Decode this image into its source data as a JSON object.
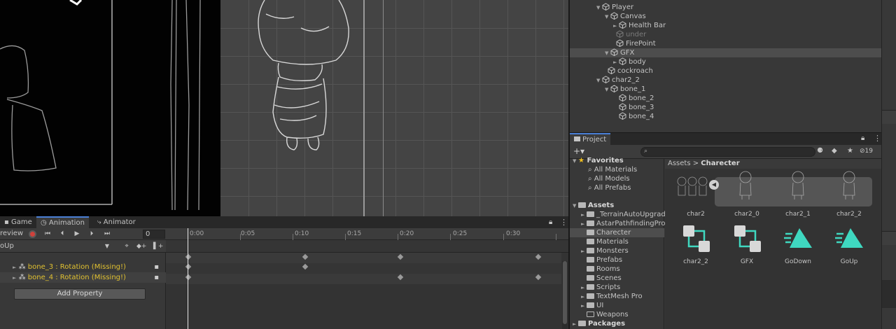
{
  "colors": {
    "accent": "#4a7fd5",
    "record": "#d0413b",
    "missing_property": "#e0c030",
    "keyframe": "#9a9a9a",
    "goup_icon": "#3fd8c0"
  },
  "hierarchy": {
    "items": [
      {
        "label": "Player",
        "icon": "cube-icon"
      },
      {
        "label": "Canvas",
        "icon": "cube-icon"
      },
      {
        "label": "Health Bar",
        "icon": "cube-icon"
      },
      {
        "label": "under",
        "icon": "cube-icon"
      },
      {
        "label": "FirePoint",
        "icon": "cube-icon"
      },
      {
        "label": "GFX",
        "icon": "cube-icon"
      },
      {
        "label": "body",
        "icon": "cube-icon"
      },
      {
        "label": "cockroach",
        "icon": "cube-icon"
      },
      {
        "label": "char2_2",
        "icon": "cube-icon"
      },
      {
        "label": "bone_1",
        "icon": "cube-icon"
      },
      {
        "label": "bone_2",
        "icon": "cube-icon"
      },
      {
        "label": "bone_3",
        "icon": "cube-icon"
      },
      {
        "label": "bone_4",
        "icon": "cube-icon"
      }
    ]
  },
  "project": {
    "tab_label": "Project",
    "hidden_count": "19",
    "breadcrumb": {
      "root": "Assets",
      "current": "Charecter"
    },
    "tree": {
      "favorites_label": "Favorites",
      "favorites": [
        "All Materials",
        "All Models",
        "All Prefabs"
      ],
      "assets_label": "Assets",
      "folders": [
        "_TerrainAutoUpgrade",
        "AstarPathfindingProject",
        "Charecter",
        "Materials",
        "Monsters",
        "Prefabs",
        "Rooms",
        "Scenes",
        "Scripts",
        "TextMesh Pro",
        "UI",
        "Weapons"
      ],
      "packages_label": "Packages"
    },
    "assets": [
      {
        "label": "char2",
        "icon": "sprite-sheet-icon"
      },
      {
        "label": "char2_0",
        "icon": "sprite-icon"
      },
      {
        "label": "char2_1",
        "icon": "sprite-icon"
      },
      {
        "label": "char2_2",
        "icon": "sprite-icon"
      },
      {
        "label": "char2_2",
        "icon": "prefab-variant-icon"
      },
      {
        "label": "GFX",
        "icon": "prefab-variant-icon"
      },
      {
        "label": "GoDown",
        "icon": "animation-clip-icon"
      },
      {
        "label": "GoUp",
        "icon": "animation-clip-icon"
      }
    ]
  },
  "animation": {
    "tabs": [
      {
        "label": "Game",
        "icon": "game-icon"
      },
      {
        "label": "Animation",
        "icon": "clock-icon"
      },
      {
        "label": "Animator",
        "icon": "animator-icon"
      }
    ],
    "preview_label": "review",
    "frame_value": "0",
    "clip_name": "oUp",
    "ticks": [
      "0:00",
      "0:05",
      "0:10",
      "0:15",
      "0:20",
      "0:25",
      "0:30"
    ],
    "properties": [
      {
        "label": "bone_3 : Rotation (Missing!)"
      },
      {
        "label": "bone_4 : Rotation (Missing!)"
      }
    ],
    "add_property_label": "Add Property"
  }
}
